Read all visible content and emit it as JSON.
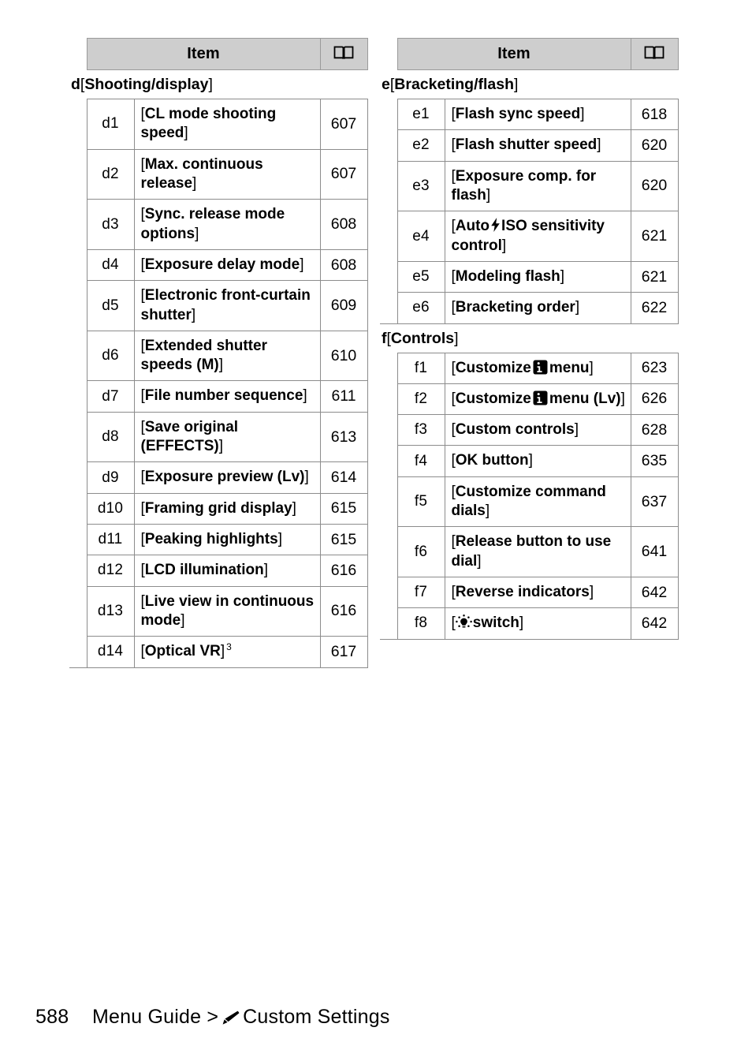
{
  "header": {
    "item_label": "Item",
    "page_icon": "book-icon"
  },
  "left_table": {
    "section": {
      "letter": "d",
      "open_bracket": "[",
      "name": "Shooting/display",
      "close_bracket": "]"
    },
    "rows": [
      {
        "code": "d1",
        "item": "CL mode shooting speed",
        "page": "607"
      },
      {
        "code": "d2",
        "item": "Max. continuous release",
        "page": "607"
      },
      {
        "code": "d3",
        "item": "Sync. release mode options",
        "page": "608"
      },
      {
        "code": "d4",
        "item": "Exposure delay mode",
        "page": "608"
      },
      {
        "code": "d5",
        "item": "Electronic front-curtain shutter",
        "page": "609"
      },
      {
        "code": "d6",
        "item": "Extended shutter speeds (M)",
        "page": "610"
      },
      {
        "code": "d7",
        "item": "File number sequence",
        "page": "611"
      },
      {
        "code": "d8",
        "item": "Save original (EFFECTS)",
        "page": "613"
      },
      {
        "code": "d9",
        "item": "Exposure preview (Lv)",
        "page": "614"
      },
      {
        "code": "d10",
        "item": "Framing grid display",
        "page": "615"
      },
      {
        "code": "d11",
        "item": "Peaking highlights",
        "page": "615"
      },
      {
        "code": "d12",
        "item": "LCD illumination",
        "page": "616"
      },
      {
        "code": "d13",
        "item": "Live view in continuous mode",
        "page": "616"
      },
      {
        "code": "d14",
        "item": "Optical VR",
        "footnote": "3",
        "page": "617"
      }
    ]
  },
  "right_table": {
    "section_e": {
      "letter": "e",
      "open_bracket": "[",
      "name": "Bracketing/flash",
      "close_bracket": "]"
    },
    "rows_e": [
      {
        "code": "e1",
        "item": "Flash sync speed",
        "page": "618"
      },
      {
        "code": "e2",
        "item": "Flash shutter speed",
        "page": "620"
      },
      {
        "code": "e3",
        "item": "Exposure comp. for flash",
        "page": "620"
      },
      {
        "code": "e4",
        "item_before": "Auto",
        "icon": "flash-icon",
        "item_after": "ISO sensitivity control",
        "page": "621"
      },
      {
        "code": "e5",
        "item": "Modeling flash",
        "page": "621"
      },
      {
        "code": "e6",
        "item": "Bracketing order",
        "page": "622"
      }
    ],
    "section_f": {
      "letter": "f",
      "open_bracket": "[",
      "name": "Controls",
      "close_bracket": "]"
    },
    "rows_f": [
      {
        "code": "f1",
        "item_before": "Customize",
        "icon": "info-icon",
        "item_after": "menu",
        "page": "623"
      },
      {
        "code": "f2",
        "item_before": "Customize",
        "icon": "info-icon",
        "item_after": "menu (Lv)",
        "page": "626"
      },
      {
        "code": "f3",
        "item": "Custom controls",
        "page": "628"
      },
      {
        "code": "f4",
        "item": "OK button",
        "page": "635"
      },
      {
        "code": "f5",
        "item": "Customize command dials",
        "page": "637"
      },
      {
        "code": "f6",
        "item": "Release button to use dial",
        "page": "641"
      },
      {
        "code": "f7",
        "item": "Reverse indicators",
        "page": "642"
      },
      {
        "code": "f8",
        "item_before": "",
        "icon": "lamp-icon",
        "item_after": "switch",
        "page": "642"
      }
    ]
  },
  "footer": {
    "page_number": "588",
    "breadcrumb_1": "Menu Guide",
    "separator": ">",
    "icon": "pencil-icon",
    "breadcrumb_2": "Custom Settings"
  }
}
